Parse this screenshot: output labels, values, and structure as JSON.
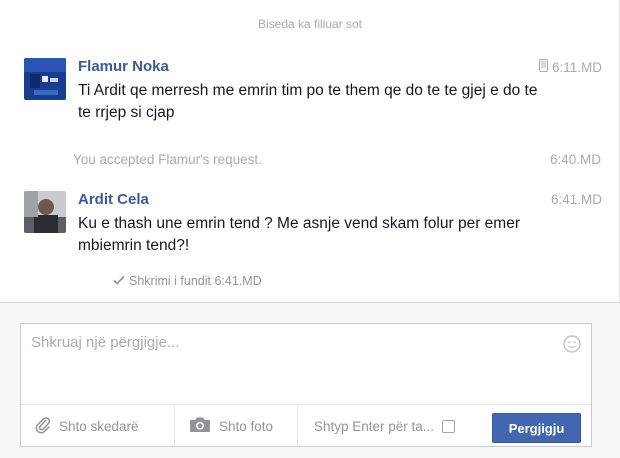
{
  "thread": {
    "started_label": "Biseda ka filluar sot",
    "messages": [
      {
        "sender": "Flamur Noka",
        "time": "6:11.MD",
        "text": "Ti Ardit qe merresh me emrin tim po te them qe do te te gjej e do te te rrjep si cjap",
        "device_icon": "mobile-phone-icon"
      },
      {
        "sender": "Ardit Cela",
        "time": "6:41.MD",
        "text": "Ku e thash une emrin tend ? Me asnje vend skam folur per emer mbiemrin tend?!"
      }
    ],
    "system": {
      "text": "You accepted Flamur's request.",
      "time": "6:40.MD"
    },
    "seen": "Shkrimi i fundit 6:41.MD"
  },
  "composer": {
    "placeholder": "Shkruaj një përgjigje...",
    "attach_label": "Shto skedarë",
    "photo_label": "Shto foto",
    "enter_label": "Shtyp Enter për ta...",
    "reply_label": "Pergjigju"
  },
  "colors": {
    "name": "#3b5998",
    "muted": "#a7abb1",
    "button": "#4267b2"
  }
}
